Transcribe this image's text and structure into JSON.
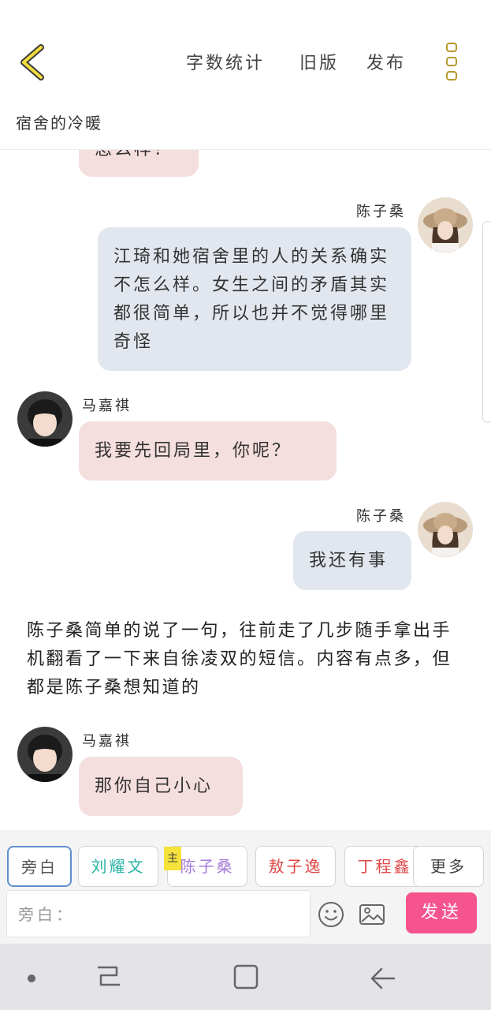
{
  "header": {
    "actions": {
      "word_count": "字数统计",
      "old_version": "旧版",
      "publish": "发布"
    },
    "work_title": "宿舍的冷暖"
  },
  "messages": {
    "m0": {
      "text": "怎么样？"
    },
    "m1": {
      "speaker": "陈子桑",
      "text": "江琦和她宿舍里的人的关系确实不怎么样。女生之间的矛盾其实都很简单，所以也并不觉得哪里奇怪"
    },
    "m2": {
      "speaker": "马嘉祺",
      "text": "我要先回局里，你呢？"
    },
    "m3": {
      "speaker": "陈子桑",
      "text": "我还有事"
    },
    "m4": {
      "text": "陈子桑简单的说了一句，往前走了几步随手拿出手机翻看了一下来自徐凌双的短信。内容有点多，但都是陈子桑想知道的"
    },
    "m5": {
      "speaker": "马嘉祺",
      "text": "那你自己小心"
    }
  },
  "roles": {
    "r0": {
      "label": "旁白",
      "color": "#555555"
    },
    "r1": {
      "label": "刘耀文",
      "color": "#2ab3a6"
    },
    "r2": {
      "label": "陈子桑",
      "color": "#a47ad6",
      "badge": "主"
    },
    "r3": {
      "label": "敖子逸",
      "color": "#e04848"
    },
    "r4": {
      "label": "丁程鑫",
      "color": "#e04848"
    },
    "more": {
      "label": "更多"
    }
  },
  "composer": {
    "placeholder": "旁白：",
    "send_label": "发送",
    "send_color": "#f5548f"
  },
  "icons": {
    "back": "chevron-left-icon",
    "menu": "vertical-menu-icon",
    "emoji": "emoji-icon",
    "image": "image-icon"
  }
}
